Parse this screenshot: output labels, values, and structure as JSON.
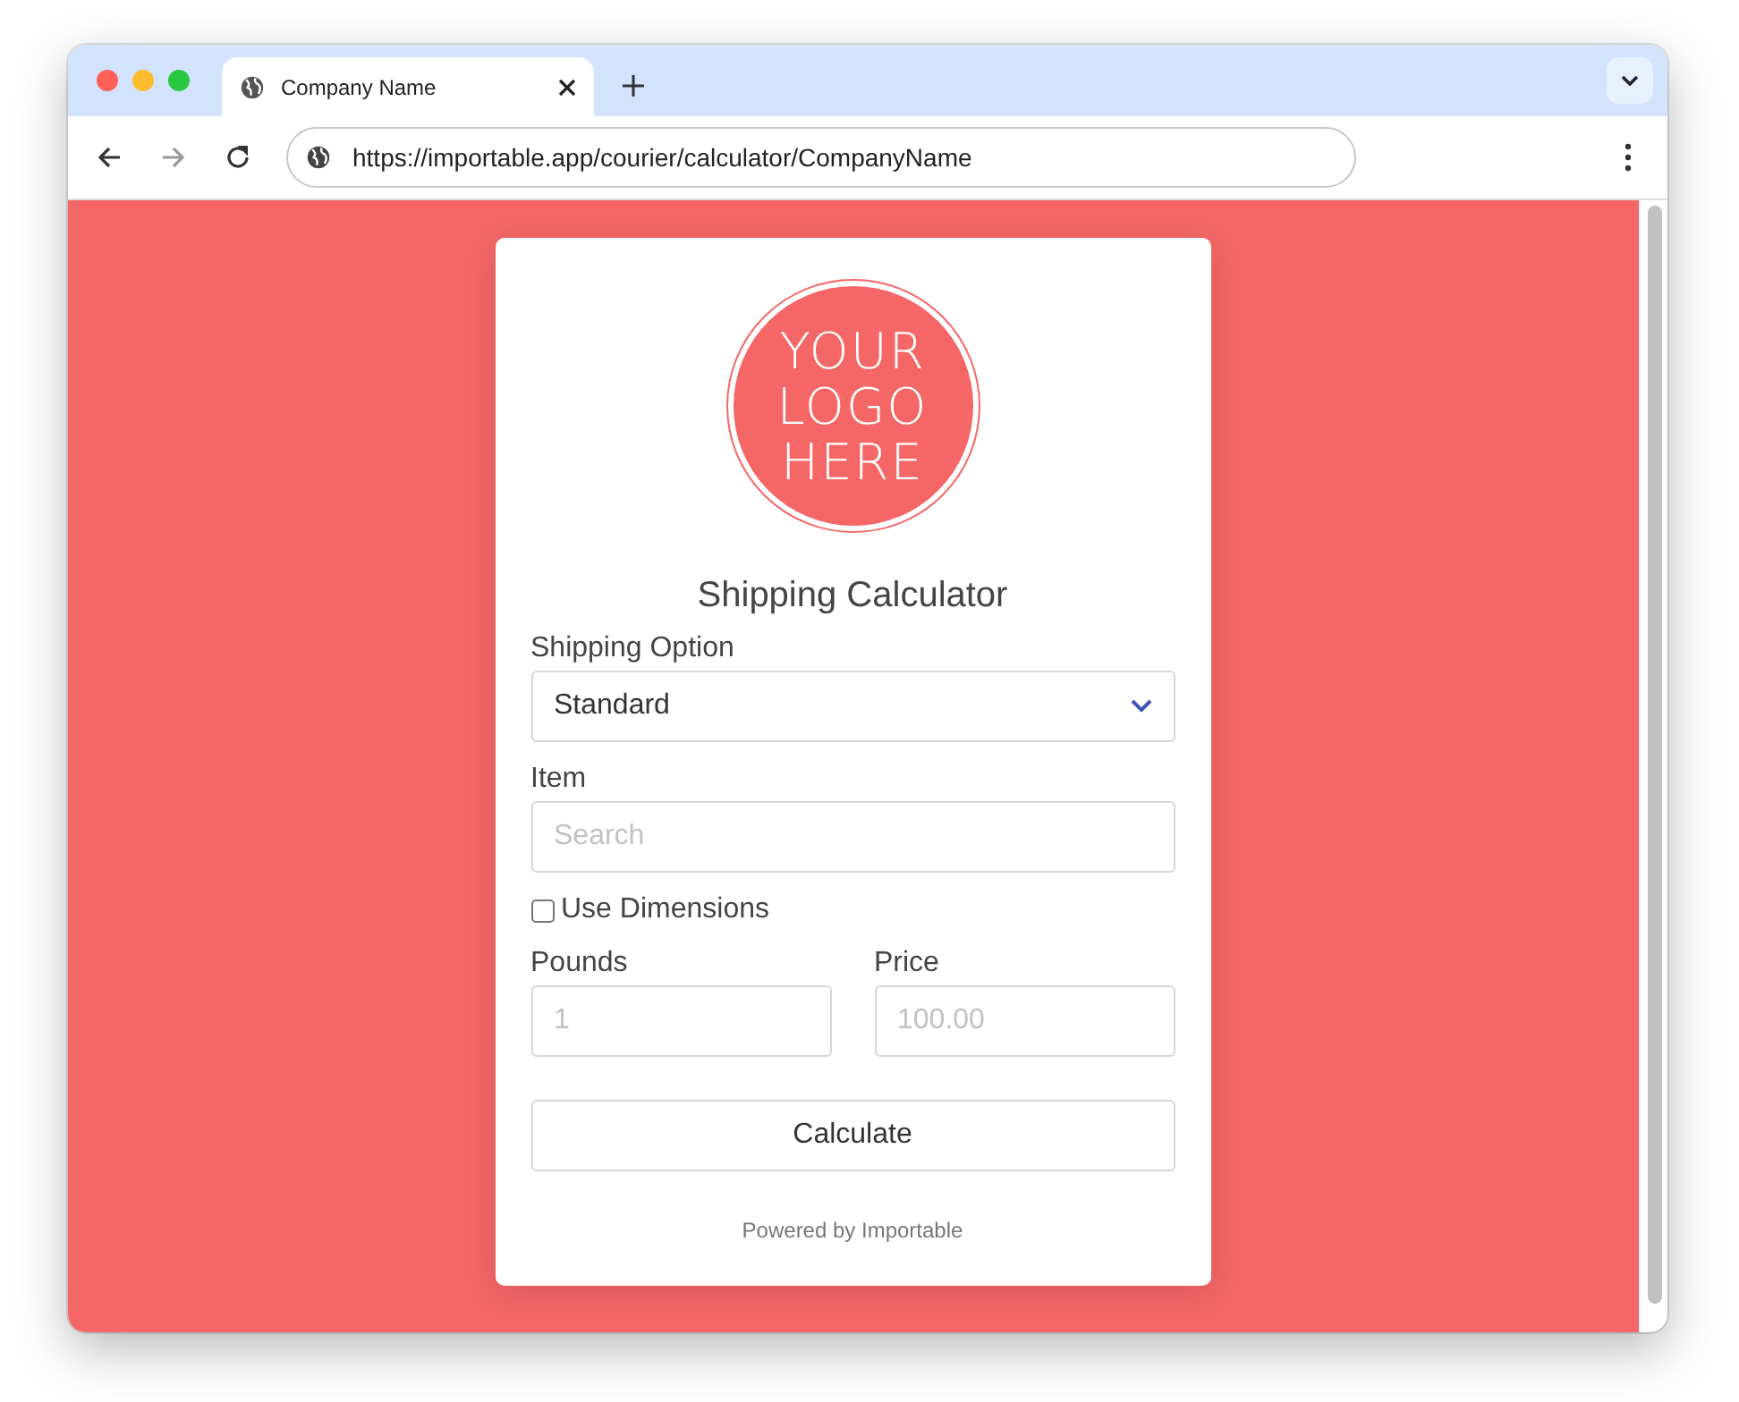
{
  "browser": {
    "tab_title": "Company Name",
    "url": "https://importable.app/courier/calculator/CompanyName"
  },
  "logo": {
    "lines": [
      "YOUR",
      "LOGO",
      "HERE"
    ]
  },
  "title": "Shipping Calculator",
  "shipping_option": {
    "label": "Shipping Option",
    "value": "Standard"
  },
  "item": {
    "label": "Item",
    "placeholder": "Search"
  },
  "use_dimensions": {
    "label": "Use Dimensions",
    "checked": false
  },
  "pounds": {
    "label": "Pounds",
    "placeholder": "1"
  },
  "price": {
    "label": "Price",
    "placeholder": "100.00"
  },
  "button": "Calculate",
  "footer": "Powered by Importable"
}
